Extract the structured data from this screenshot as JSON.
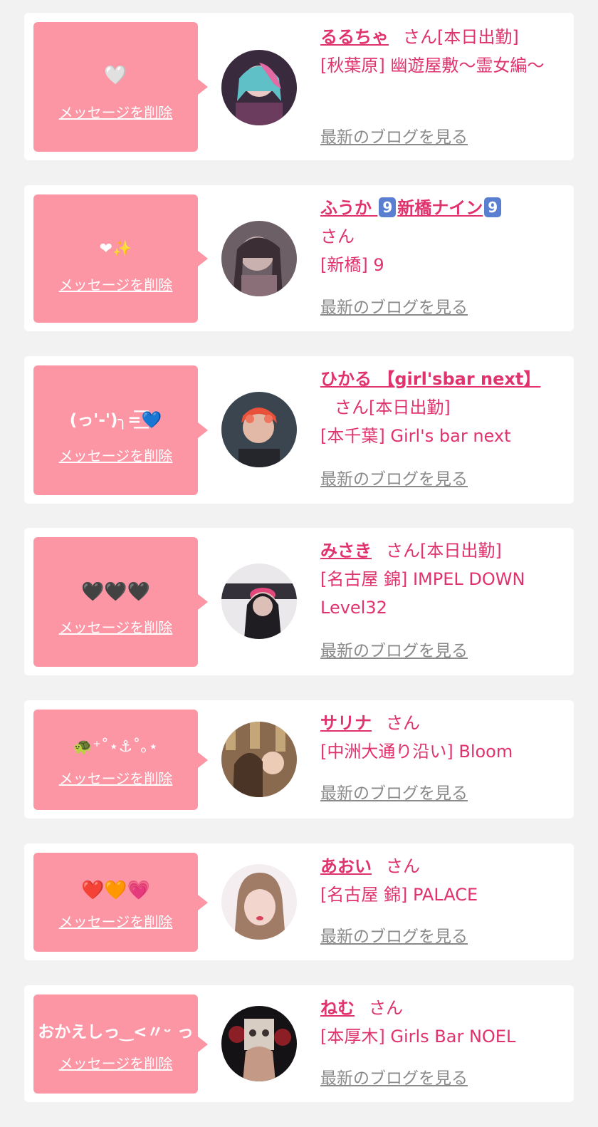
{
  "colors": {
    "accent": "#e0336d",
    "bubble": "#fc95a4",
    "muted": "#8a8a8a"
  },
  "delete_label": "メッセージを削除",
  "blog_label": "最新のブログを見る",
  "cards": [
    {
      "message": "🤍",
      "name": "るるちゃ",
      "san": "さん",
      "tag": "[本日出勤]",
      "location": "[秋葉原] 幽遊屋敷〜霊女編〜"
    },
    {
      "message": "❤✨",
      "name_pre": "ふうか ",
      "badge1": "9",
      "name_mid": "新橋ナイン",
      "badge2": "9",
      "san": "さん",
      "location": "[新橋] 9"
    },
    {
      "message": "(っ'-')╮=͟͟͞͞💙",
      "name": "ひかる 【girl'sbar next】",
      "san": "さん",
      "tag": "[本日出勤]",
      "location": "[本千葉] Girl's bar next"
    },
    {
      "message": "🖤🖤🖤",
      "name": "みさき",
      "san": "さん",
      "tag": "[本日出勤]",
      "location": "[名古屋 錦] IMPEL DOWN Level32"
    },
    {
      "message": "🐢⁺˚⋆⚓︎˚｡⋆",
      "name": "サリナ",
      "san": "さん",
      "location": "[中洲大通り沿い] Bloom"
    },
    {
      "message": "❤️🧡💗",
      "name": "あおい",
      "san": "さん",
      "location": "[名古屋 錦] PALACE"
    },
    {
      "message": "おかえしっ‿<〃ᵕ っ",
      "name": "ねむ",
      "san": "さん",
      "location": "[本厚木] Girls Bar NOEL"
    }
  ]
}
